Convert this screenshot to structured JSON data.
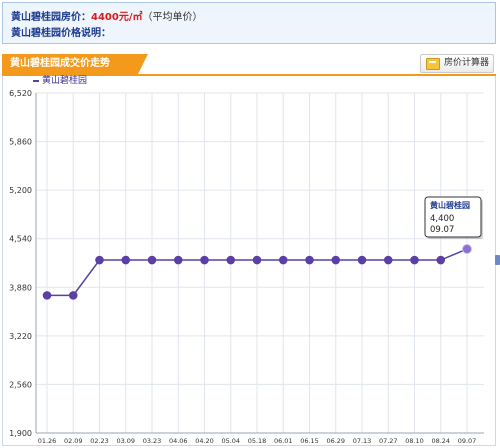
{
  "header": {
    "price_label": "黄山碧桂园房价：",
    "price_value": "4400元/㎡",
    "price_note": "（平均单价）",
    "desc_label": "黄山碧桂园价格说明："
  },
  "tab": {
    "title": "黄山碧桂园成交价走势",
    "calc_button_label": "房价计算器",
    "calc_icon": "calculator-icon"
  },
  "colors": {
    "accent_orange": "#f39a1d",
    "series_purple": "#5b3fa6",
    "price_red": "#d61b1b",
    "header_navy": "#1c3b8f"
  },
  "chart_data": {
    "type": "line",
    "title": "",
    "xlabel": "",
    "ylabel": "",
    "categories": [
      "01.26",
      "02.09",
      "02.23",
      "03.09",
      "03.23",
      "04.06",
      "04.20",
      "05.04",
      "05.18",
      "06.01",
      "06.15",
      "06.29",
      "07.13",
      "07.27",
      "08.10",
      "08.24",
      "09.07"
    ],
    "series": [
      {
        "name": "黄山碧桂园",
        "values": [
          3770,
          3770,
          4250,
          4250,
          4250,
          4250,
          4250,
          4250,
          4250,
          4250,
          4250,
          4250,
          4250,
          4250,
          4250,
          4250,
          4400
        ]
      }
    ],
    "y_ticks": [
      "6,520",
      "5,860",
      "5,200",
      "4,540",
      "3,880",
      "3,220",
      "2,560",
      "1,900"
    ],
    "ylim": [
      1900,
      6520
    ],
    "grid": true,
    "legend": "top-left",
    "tooltip": {
      "series": "黄山碧桂园",
      "value": "4,400",
      "date": "09.07"
    }
  }
}
